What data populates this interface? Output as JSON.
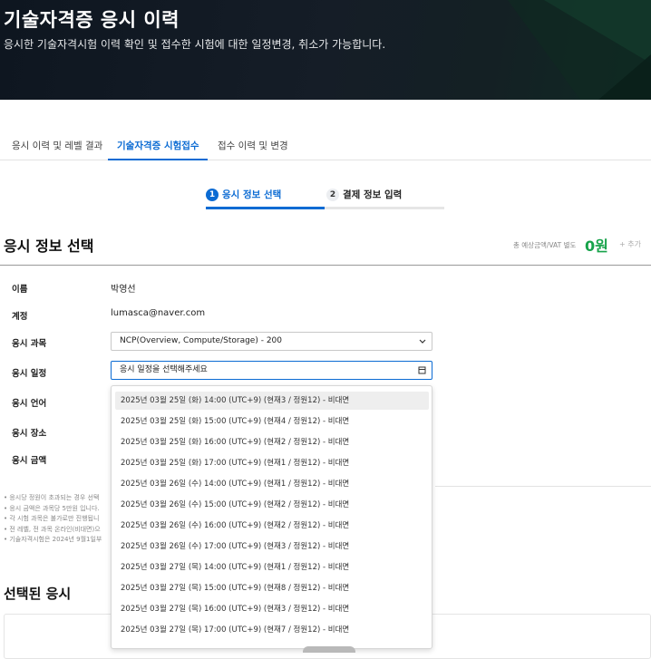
{
  "banner": {
    "title": "기술자격증 응시 이력",
    "description": "응시한 기술자격시험 이력 확인 및 접수한 시험에 대한 일정변경, 취소가 가능합니다."
  },
  "tabs": [
    {
      "label": "응시 이력 및 레벨 결과",
      "active": false
    },
    {
      "label": "기술자격증 시험접수",
      "active": true
    },
    {
      "label": "접수 이력 및 변경",
      "active": false
    }
  ],
  "steps": [
    {
      "number": "1",
      "label": "응시 정보 선택",
      "active": true
    },
    {
      "number": "2",
      "label": "결제 정보 입력",
      "active": false
    }
  ],
  "section": {
    "title": "응시 정보 선택",
    "total_label": "총 예상금액/VAT 별도",
    "total_value": "0원",
    "add_label": "+ 추가"
  },
  "form": {
    "name_label": "이름",
    "name_value": "박영선",
    "account_label": "계정",
    "account_value": "lumasca@naver.com",
    "subject_label": "응시 과목",
    "subject_value": "NCP(Overview, Compute/Storage) - 200",
    "date_label": "응시 일정",
    "date_placeholder": "응시 일정을 선택해주세요",
    "language_label": "응시 언어",
    "place_label": "응시 장소",
    "fee_label": "응시 금액"
  },
  "notes": [
    "• 응시당 정원이 초과되는 경우 선택",
    "• 응시 금액은 과목당 5만원 입니다.",
    "• 각 시험 과목은 불가로만 진행됩니",
    "• 전 레벨, 전 과목 온라인(비대면)으",
    "• 기술자격시험은 2024년 9월1일부"
  ],
  "selected_title": "선택된 응시",
  "schedule_options": [
    "2025년 03월 25일 (화) 14:00 (UTC+9) (현재3 / 정원12) - 비대면",
    "2025년 03월 25일 (화) 15:00 (UTC+9) (현재4 / 정원12) - 비대면",
    "2025년 03월 25일 (화) 16:00 (UTC+9) (현재2 / 정원12) - 비대면",
    "2025년 03월 25일 (화) 17:00 (UTC+9) (현재1 / 정원12) - 비대면",
    "2025년 03월 26일 (수) 14:00 (UTC+9) (현재1 / 정원12) - 비대면",
    "2025년 03월 26일 (수) 15:00 (UTC+9) (현재2 / 정원12) - 비대면",
    "2025년 03월 26일 (수) 16:00 (UTC+9) (현재2 / 정원12) - 비대면",
    "2025년 03월 26일 (수) 17:00 (UTC+9) (현재3 / 정원12) - 비대면",
    "2025년 03월 27일 (목) 14:00 (UTC+9) (현재1 / 정원12) - 비대면",
    "2025년 03월 27일 (목) 15:00 (UTC+9) (현재8 / 정원12) - 비대면",
    "2025년 03월 27일 (목) 16:00 (UTC+9) (현재3 / 정원12) - 비대면",
    "2025년 03월 27일 (목) 17:00 (UTC+9) (현재7 / 정원12) - 비대면"
  ],
  "colors": {
    "accent": "#0b6bd3",
    "total": "#17a34a"
  },
  "icons": {
    "subject_select": "chevron-down-icon",
    "date_select": "calendar-icon"
  }
}
